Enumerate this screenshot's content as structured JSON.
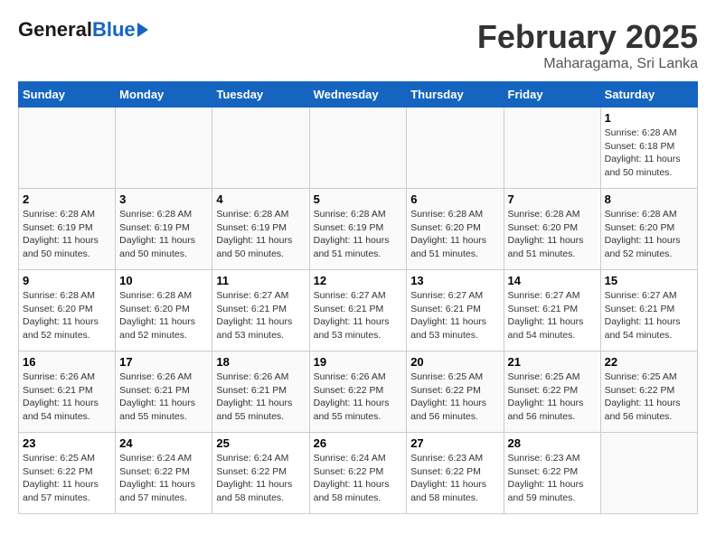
{
  "header": {
    "logo_general": "General",
    "logo_blue": "Blue",
    "month_title": "February 2025",
    "location": "Maharagama, Sri Lanka"
  },
  "days_of_week": [
    "Sunday",
    "Monday",
    "Tuesday",
    "Wednesday",
    "Thursday",
    "Friday",
    "Saturday"
  ],
  "weeks": [
    [
      {
        "day": "",
        "info": ""
      },
      {
        "day": "",
        "info": ""
      },
      {
        "day": "",
        "info": ""
      },
      {
        "day": "",
        "info": ""
      },
      {
        "day": "",
        "info": ""
      },
      {
        "day": "",
        "info": ""
      },
      {
        "day": "1",
        "info": "Sunrise: 6:28 AM\nSunset: 6:18 PM\nDaylight: 11 hours and 50 minutes."
      }
    ],
    [
      {
        "day": "2",
        "info": "Sunrise: 6:28 AM\nSunset: 6:19 PM\nDaylight: 11 hours and 50 minutes."
      },
      {
        "day": "3",
        "info": "Sunrise: 6:28 AM\nSunset: 6:19 PM\nDaylight: 11 hours and 50 minutes."
      },
      {
        "day": "4",
        "info": "Sunrise: 6:28 AM\nSunset: 6:19 PM\nDaylight: 11 hours and 50 minutes."
      },
      {
        "day": "5",
        "info": "Sunrise: 6:28 AM\nSunset: 6:19 PM\nDaylight: 11 hours and 51 minutes."
      },
      {
        "day": "6",
        "info": "Sunrise: 6:28 AM\nSunset: 6:20 PM\nDaylight: 11 hours and 51 minutes."
      },
      {
        "day": "7",
        "info": "Sunrise: 6:28 AM\nSunset: 6:20 PM\nDaylight: 11 hours and 51 minutes."
      },
      {
        "day": "8",
        "info": "Sunrise: 6:28 AM\nSunset: 6:20 PM\nDaylight: 11 hours and 52 minutes."
      }
    ],
    [
      {
        "day": "9",
        "info": "Sunrise: 6:28 AM\nSunset: 6:20 PM\nDaylight: 11 hours and 52 minutes."
      },
      {
        "day": "10",
        "info": "Sunrise: 6:28 AM\nSunset: 6:20 PM\nDaylight: 11 hours and 52 minutes."
      },
      {
        "day": "11",
        "info": "Sunrise: 6:27 AM\nSunset: 6:21 PM\nDaylight: 11 hours and 53 minutes."
      },
      {
        "day": "12",
        "info": "Sunrise: 6:27 AM\nSunset: 6:21 PM\nDaylight: 11 hours and 53 minutes."
      },
      {
        "day": "13",
        "info": "Sunrise: 6:27 AM\nSunset: 6:21 PM\nDaylight: 11 hours and 53 minutes."
      },
      {
        "day": "14",
        "info": "Sunrise: 6:27 AM\nSunset: 6:21 PM\nDaylight: 11 hours and 54 minutes."
      },
      {
        "day": "15",
        "info": "Sunrise: 6:27 AM\nSunset: 6:21 PM\nDaylight: 11 hours and 54 minutes."
      }
    ],
    [
      {
        "day": "16",
        "info": "Sunrise: 6:26 AM\nSunset: 6:21 PM\nDaylight: 11 hours and 54 minutes."
      },
      {
        "day": "17",
        "info": "Sunrise: 6:26 AM\nSunset: 6:21 PM\nDaylight: 11 hours and 55 minutes."
      },
      {
        "day": "18",
        "info": "Sunrise: 6:26 AM\nSunset: 6:21 PM\nDaylight: 11 hours and 55 minutes."
      },
      {
        "day": "19",
        "info": "Sunrise: 6:26 AM\nSunset: 6:22 PM\nDaylight: 11 hours and 55 minutes."
      },
      {
        "day": "20",
        "info": "Sunrise: 6:25 AM\nSunset: 6:22 PM\nDaylight: 11 hours and 56 minutes."
      },
      {
        "day": "21",
        "info": "Sunrise: 6:25 AM\nSunset: 6:22 PM\nDaylight: 11 hours and 56 minutes."
      },
      {
        "day": "22",
        "info": "Sunrise: 6:25 AM\nSunset: 6:22 PM\nDaylight: 11 hours and 56 minutes."
      }
    ],
    [
      {
        "day": "23",
        "info": "Sunrise: 6:25 AM\nSunset: 6:22 PM\nDaylight: 11 hours and 57 minutes."
      },
      {
        "day": "24",
        "info": "Sunrise: 6:24 AM\nSunset: 6:22 PM\nDaylight: 11 hours and 57 minutes."
      },
      {
        "day": "25",
        "info": "Sunrise: 6:24 AM\nSunset: 6:22 PM\nDaylight: 11 hours and 58 minutes."
      },
      {
        "day": "26",
        "info": "Sunrise: 6:24 AM\nSunset: 6:22 PM\nDaylight: 11 hours and 58 minutes."
      },
      {
        "day": "27",
        "info": "Sunrise: 6:23 AM\nSunset: 6:22 PM\nDaylight: 11 hours and 58 minutes."
      },
      {
        "day": "28",
        "info": "Sunrise: 6:23 AM\nSunset: 6:22 PM\nDaylight: 11 hours and 59 minutes."
      },
      {
        "day": "",
        "info": ""
      }
    ]
  ]
}
